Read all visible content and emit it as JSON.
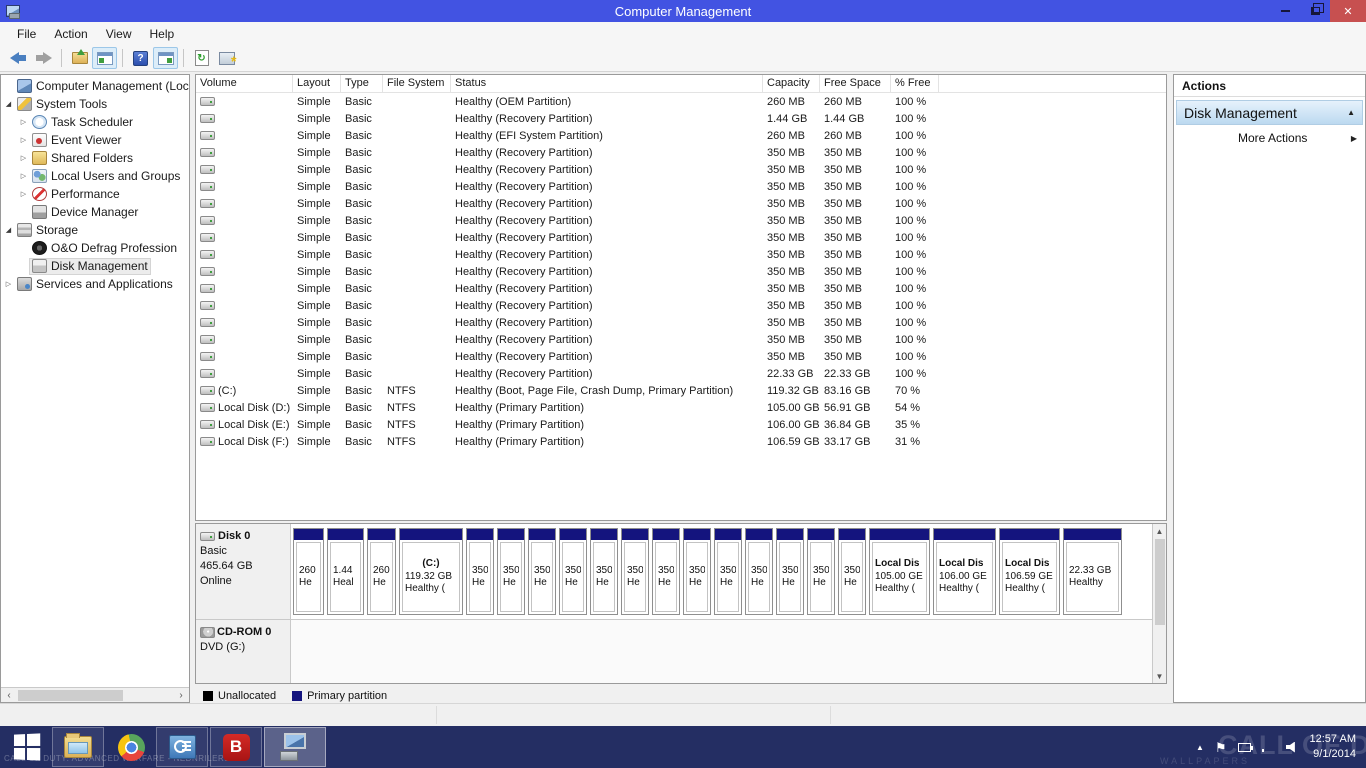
{
  "colors": {
    "titlebar": "#4253e2",
    "close": "#c75050",
    "navy": "#14147e",
    "taskbar": "#242e63"
  },
  "window": {
    "title": "Computer Management"
  },
  "menu": {
    "items": [
      "File",
      "Action",
      "View",
      "Help"
    ]
  },
  "toolbar": {
    "buttons": [
      "back",
      "forward",
      "up-folder",
      "show-console-tree",
      "help",
      "show-action-pane",
      "refresh",
      "console-options"
    ]
  },
  "sidebar": {
    "items": [
      {
        "depth": 0,
        "expander": "none",
        "icon": "computer",
        "label": "Computer Management (Local"
      },
      {
        "depth": 0,
        "expander": "expanded",
        "icon": "tools",
        "label": "System Tools"
      },
      {
        "depth": 1,
        "expander": "collapsed",
        "icon": "clock",
        "label": "Task Scheduler"
      },
      {
        "depth": 1,
        "expander": "collapsed",
        "icon": "event",
        "label": "Event Viewer"
      },
      {
        "depth": 1,
        "expander": "collapsed",
        "icon": "shared",
        "label": "Shared Folders"
      },
      {
        "depth": 1,
        "expander": "collapsed",
        "icon": "users",
        "label": "Local Users and Groups"
      },
      {
        "depth": 1,
        "expander": "collapsed",
        "icon": "performance",
        "label": "Performance"
      },
      {
        "depth": 1,
        "expander": "none",
        "icon": "device",
        "label": "Device Manager"
      },
      {
        "depth": 0,
        "expander": "expanded",
        "icon": "storage",
        "label": "Storage"
      },
      {
        "depth": 1,
        "expander": "none",
        "icon": "defrag",
        "label": "O&O Defrag Profession"
      },
      {
        "depth": 1,
        "expander": "none",
        "icon": "disk",
        "label": "Disk Management",
        "selected": true
      },
      {
        "depth": 0,
        "expander": "collapsed",
        "icon": "services",
        "label": "Services and Applications"
      }
    ]
  },
  "volume_table": {
    "columns": [
      "Volume",
      "Layout",
      "Type",
      "File System",
      "Status",
      "Capacity",
      "Free Space",
      "% Free"
    ],
    "rows": [
      {
        "volume": "",
        "layout": "Simple",
        "type": "Basic",
        "fs": "",
        "status": "Healthy (OEM Partition)",
        "capacity": "260 MB",
        "free": "260 MB",
        "pct_free": "100 %"
      },
      {
        "volume": "",
        "layout": "Simple",
        "type": "Basic",
        "fs": "",
        "status": "Healthy (Recovery Partition)",
        "capacity": "1.44 GB",
        "free": "1.44 GB",
        "pct_free": "100 %"
      },
      {
        "volume": "",
        "layout": "Simple",
        "type": "Basic",
        "fs": "",
        "status": "Healthy (EFI System Partition)",
        "capacity": "260 MB",
        "free": "260 MB",
        "pct_free": "100 %"
      },
      {
        "volume": "",
        "layout": "Simple",
        "type": "Basic",
        "fs": "",
        "status": "Healthy (Recovery Partition)",
        "capacity": "350 MB",
        "free": "350 MB",
        "pct_free": "100 %"
      },
      {
        "volume": "",
        "layout": "Simple",
        "type": "Basic",
        "fs": "",
        "status": "Healthy (Recovery Partition)",
        "capacity": "350 MB",
        "free": "350 MB",
        "pct_free": "100 %"
      },
      {
        "volume": "",
        "layout": "Simple",
        "type": "Basic",
        "fs": "",
        "status": "Healthy (Recovery Partition)",
        "capacity": "350 MB",
        "free": "350 MB",
        "pct_free": "100 %"
      },
      {
        "volume": "",
        "layout": "Simple",
        "type": "Basic",
        "fs": "",
        "status": "Healthy (Recovery Partition)",
        "capacity": "350 MB",
        "free": "350 MB",
        "pct_free": "100 %"
      },
      {
        "volume": "",
        "layout": "Simple",
        "type": "Basic",
        "fs": "",
        "status": "Healthy (Recovery Partition)",
        "capacity": "350 MB",
        "free": "350 MB",
        "pct_free": "100 %"
      },
      {
        "volume": "",
        "layout": "Simple",
        "type": "Basic",
        "fs": "",
        "status": "Healthy (Recovery Partition)",
        "capacity": "350 MB",
        "free": "350 MB",
        "pct_free": "100 %"
      },
      {
        "volume": "",
        "layout": "Simple",
        "type": "Basic",
        "fs": "",
        "status": "Healthy (Recovery Partition)",
        "capacity": "350 MB",
        "free": "350 MB",
        "pct_free": "100 %"
      },
      {
        "volume": "",
        "layout": "Simple",
        "type": "Basic",
        "fs": "",
        "status": "Healthy (Recovery Partition)",
        "capacity": "350 MB",
        "free": "350 MB",
        "pct_free": "100 %"
      },
      {
        "volume": "",
        "layout": "Simple",
        "type": "Basic",
        "fs": "",
        "status": "Healthy (Recovery Partition)",
        "capacity": "350 MB",
        "free": "350 MB",
        "pct_free": "100 %"
      },
      {
        "volume": "",
        "layout": "Simple",
        "type": "Basic",
        "fs": "",
        "status": "Healthy (Recovery Partition)",
        "capacity": "350 MB",
        "free": "350 MB",
        "pct_free": "100 %"
      },
      {
        "volume": "",
        "layout": "Simple",
        "type": "Basic",
        "fs": "",
        "status": "Healthy (Recovery Partition)",
        "capacity": "350 MB",
        "free": "350 MB",
        "pct_free": "100 %"
      },
      {
        "volume": "",
        "layout": "Simple",
        "type": "Basic",
        "fs": "",
        "status": "Healthy (Recovery Partition)",
        "capacity": "350 MB",
        "free": "350 MB",
        "pct_free": "100 %"
      },
      {
        "volume": "",
        "layout": "Simple",
        "type": "Basic",
        "fs": "",
        "status": "Healthy (Recovery Partition)",
        "capacity": "350 MB",
        "free": "350 MB",
        "pct_free": "100 %"
      },
      {
        "volume": "",
        "layout": "Simple",
        "type": "Basic",
        "fs": "",
        "status": "Healthy (Recovery Partition)",
        "capacity": "22.33 GB",
        "free": "22.33 GB",
        "pct_free": "100 %"
      },
      {
        "volume": "(C:)",
        "layout": "Simple",
        "type": "Basic",
        "fs": "NTFS",
        "status": "Healthy (Boot, Page File, Crash Dump, Primary Partition)",
        "capacity": "119.32 GB",
        "free": "83.16 GB",
        "pct_free": "70 %"
      },
      {
        "volume": "Local Disk (D:)",
        "layout": "Simple",
        "type": "Basic",
        "fs": "NTFS",
        "status": "Healthy (Primary Partition)",
        "capacity": "105.00 GB",
        "free": "56.91 GB",
        "pct_free": "54 %"
      },
      {
        "volume": "Local Disk (E:)",
        "layout": "Simple",
        "type": "Basic",
        "fs": "NTFS",
        "status": "Healthy (Primary Partition)",
        "capacity": "106.00 GB",
        "free": "36.84 GB",
        "pct_free": "35 %"
      },
      {
        "volume": "Local Disk (F:)",
        "layout": "Simple",
        "type": "Basic",
        "fs": "NTFS",
        "status": "Healthy (Primary Partition)",
        "capacity": "106.59 GB",
        "free": "33.17 GB",
        "pct_free": "31 %"
      }
    ]
  },
  "disk_view": {
    "disk0": {
      "name": "Disk 0",
      "type": "Basic",
      "size": "465.64 GB",
      "status": "Online",
      "partitions": [
        {
          "w": 31,
          "lines": [
            "260",
            "He"
          ]
        },
        {
          "w": 37,
          "lines": [
            "1.44",
            "Heal"
          ]
        },
        {
          "w": 29,
          "lines": [
            "260",
            "He"
          ]
        },
        {
          "w": 64,
          "lines": [
            "(C:)",
            "119.32 GB",
            "Healthy ("
          ],
          "name_bold": true,
          "center_first": true
        },
        {
          "w": 28,
          "lines": [
            "350",
            "He"
          ],
          "repeat": 13
        },
        {
          "w": 61,
          "lines": [
            "Local Dis",
            "105.00 GE",
            "Healthy ("
          ],
          "name_bold": true
        },
        {
          "w": 63,
          "lines": [
            "Local Dis",
            "106.00 GE",
            "Healthy ("
          ],
          "name_bold": true
        },
        {
          "w": 61,
          "lines": [
            "Local Dis",
            "106.59 GE",
            "Healthy ("
          ],
          "name_bold": true
        },
        {
          "w": 59,
          "lines": [
            "22.33 GB",
            "Healthy"
          ]
        }
      ]
    },
    "cdrom": {
      "name": "CD-ROM 0",
      "media": "DVD (G:)"
    }
  },
  "legend": {
    "items": [
      {
        "label": "Unallocated",
        "color": "#000000"
      },
      {
        "label": "Primary partition",
        "color": "#14147e"
      }
    ]
  },
  "actions": {
    "title": "Actions",
    "section": "Disk Management",
    "more": "More Actions"
  },
  "taskbar": {
    "clock": {
      "time": "12:57 AM",
      "date": "9/1/2014"
    },
    "wallpaper_text": {
      "bottom_left": "CALL OF DUTY: ADVANCED WARFARE - NEDNRILER99",
      "big_right": "CALL OF DUTY",
      "watermark": "WALLPAPERS"
    }
  }
}
